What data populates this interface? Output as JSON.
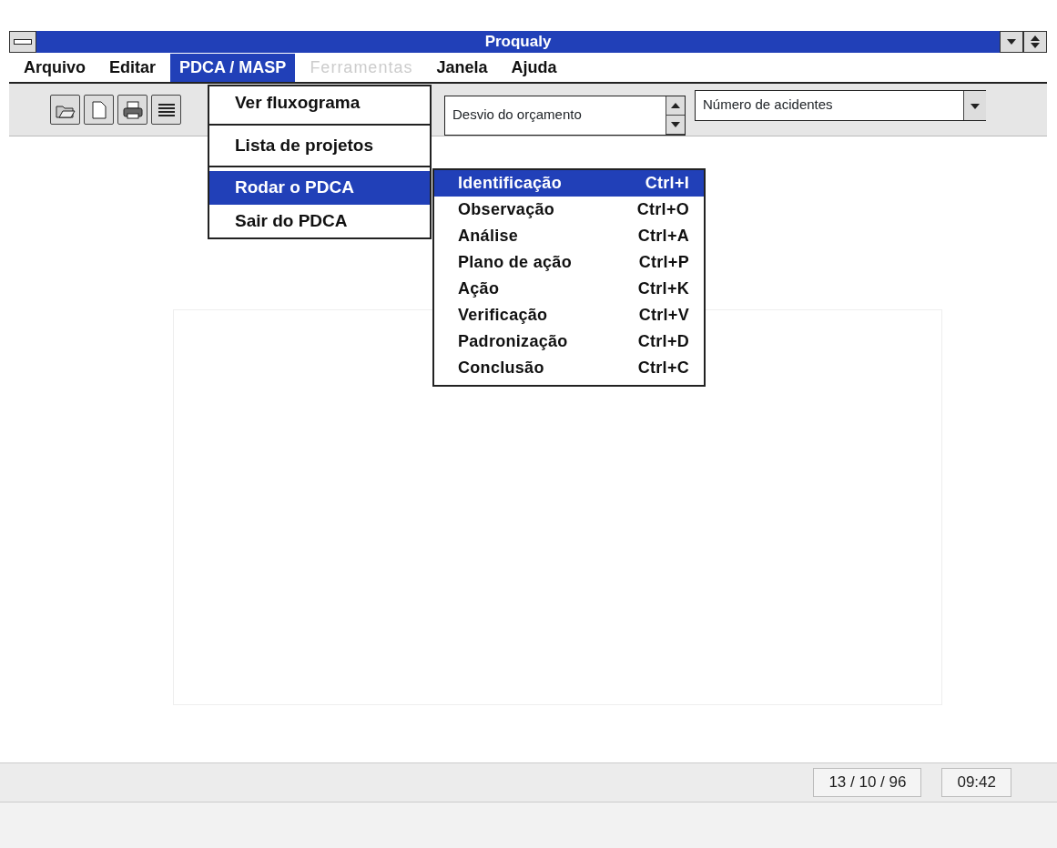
{
  "window": {
    "title": "Proqualy"
  },
  "menu_bar": [
    {
      "label": "Arquivo",
      "selected": false,
      "disabled": false
    },
    {
      "label": "Editar",
      "selected": false,
      "disabled": false
    },
    {
      "label": "PDCA / MASP",
      "selected": true,
      "disabled": false
    },
    {
      "label": "Ferramentas",
      "selected": false,
      "disabled": true
    },
    {
      "label": "Janela",
      "selected": false,
      "disabled": false
    },
    {
      "label": "Ajuda",
      "selected": false,
      "disabled": false
    }
  ],
  "toolbar": {
    "combo_1": {
      "value": "Desvio do orçamento"
    },
    "combo_2": {
      "value": "Número de acidentes"
    }
  },
  "dropdown_menu": [
    {
      "label": "Ver fluxograma",
      "selected": false
    },
    {
      "label": "Lista de projetos",
      "selected": false
    },
    {
      "label": "Rodar o PDCA",
      "selected": true
    },
    {
      "label": "Sair do PDCA",
      "selected": false
    }
  ],
  "submenu": [
    {
      "label": "Identificação",
      "shortcut": "Ctrl+I",
      "selected": true
    },
    {
      "label": "Observação",
      "shortcut": "Ctrl+O",
      "selected": false
    },
    {
      "label": "Análise",
      "shortcut": "Ctrl+A",
      "selected": false
    },
    {
      "label": "Plano de ação",
      "shortcut": "Ctrl+P",
      "selected": false
    },
    {
      "label": "Ação",
      "shortcut": "Ctrl+K",
      "selected": false
    },
    {
      "label": "Verificação",
      "shortcut": "Ctrl+V",
      "selected": false
    },
    {
      "label": "Padronização",
      "shortcut": "Ctrl+D",
      "selected": false
    },
    {
      "label": "Conclusão",
      "shortcut": "Ctrl+C",
      "selected": false
    }
  ],
  "status_bar": {
    "date": "13 / 10 / 96",
    "time": "09:42"
  }
}
